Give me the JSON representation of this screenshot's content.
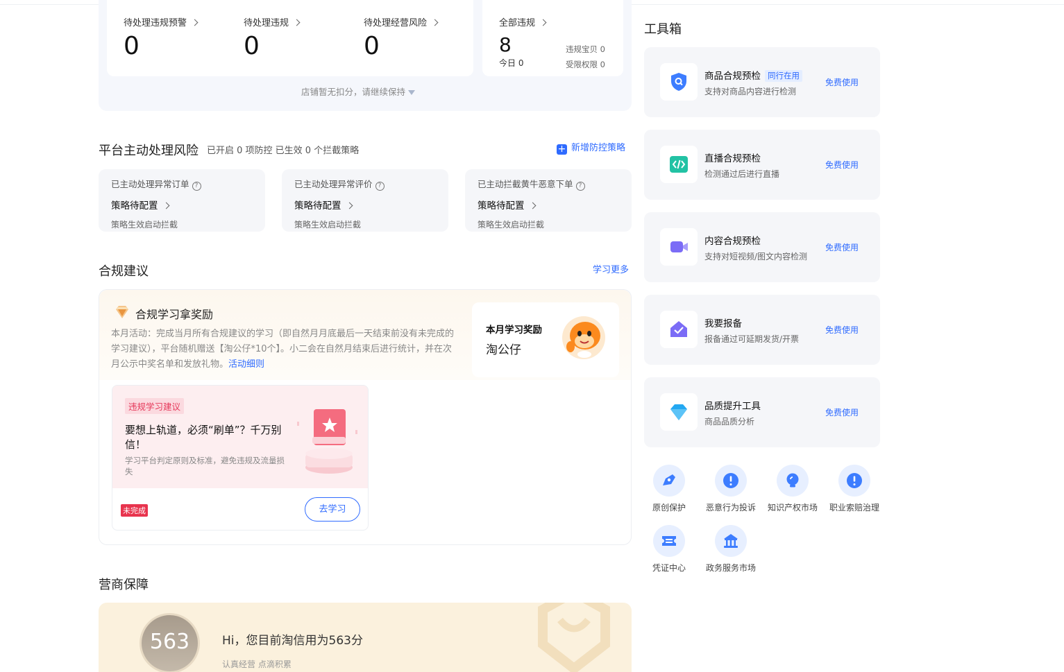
{
  "stats": {
    "items": [
      {
        "label": "待处理违规预警",
        "value": "0"
      },
      {
        "label": "待处理违规",
        "value": "0"
      },
      {
        "label": "待处理经营风险",
        "value": "0"
      }
    ],
    "all": {
      "label": "全部违规",
      "value": "8",
      "today_label": "今日",
      "today_value": "0",
      "bad_items_label": "违规宝贝",
      "bad_items_value": "0",
      "restricted_label": "受限权限",
      "restricted_value": "0"
    },
    "footer": "店铺暂无扣分，请继续保持"
  },
  "platform_risk": {
    "title": "平台主动处理风险",
    "summary": "已开启 0 项防控 已生效 0 个拦截策略",
    "add_link": "新增防控策略",
    "cards": [
      {
        "title": "已主动处理异常订单",
        "status": "策略待配置",
        "note": "策略生效启动拦截"
      },
      {
        "title": "已主动处理异常评价",
        "status": "策略待配置",
        "note": "策略生效启动拦截"
      },
      {
        "title": "已主动拦截黄牛恶意下单",
        "status": "策略待配置",
        "note": "策略生效启动拦截"
      }
    ]
  },
  "advice": {
    "title": "合规建议",
    "more_link": "学习更多",
    "reward": {
      "title": "合规学习拿奖励",
      "text": "本月活动：完成当月所有合规建议的学习（即自然月月底最后一天结束前没有未完成的学习建议），平台随机赠送【淘公仔*10个】。小二会在自然月结束后进行统计，并在次月公示中奖名单和发放礼物。",
      "detail_link": "活动细则",
      "box_title": "本月学习奖励",
      "box_value": "淘公仔"
    },
    "card": {
      "tag": "违规学习建议",
      "title": "要想上轨道，必须“刷单”？千万别信！",
      "desc": "学习平台判定原则及标准，避免违规及流量损失",
      "status": "未完成",
      "button": "去学习"
    }
  },
  "guarantee": {
    "title": "营商保障",
    "score": "563",
    "text": "Hi，您目前淘信用为563分",
    "sub": "认真经营 点滴积累"
  },
  "toolbox": {
    "title": "工具箱",
    "tools": [
      {
        "name": "商品合规预检",
        "badge": "同行在用",
        "desc": "支持对商品内容进行检测",
        "link": "免费使用",
        "icon": "shield-search-icon"
      },
      {
        "name": "直播合规预检",
        "badge": "",
        "desc": "检测通过后进行直播",
        "link": "免费使用",
        "icon": "code-icon"
      },
      {
        "name": "内容合规预检",
        "badge": "",
        "desc": "支持对短视频/图文内容检测",
        "link": "免费使用",
        "icon": "video-icon"
      },
      {
        "name": "我要报备",
        "badge": "",
        "desc": "报备通过可延期发货/开票",
        "link": "免费使用",
        "icon": "house-check-icon"
      },
      {
        "name": "品质提升工具",
        "badge": "",
        "desc": "商品品质分析",
        "link": "免费使用",
        "icon": "diamond-icon"
      }
    ],
    "grid": [
      {
        "label": "原创保护",
        "icon": "edit-icon"
      },
      {
        "label": "恶意行为投诉",
        "icon": "alert-icon"
      },
      {
        "label": "知识产权市场",
        "icon": "bulb-icon"
      },
      {
        "label": "职业索赔治理",
        "icon": "alert-icon"
      },
      {
        "label": "凭证中心",
        "icon": "ticket-icon"
      },
      {
        "label": "政务服务市场",
        "icon": "bank-icon"
      }
    ]
  }
}
